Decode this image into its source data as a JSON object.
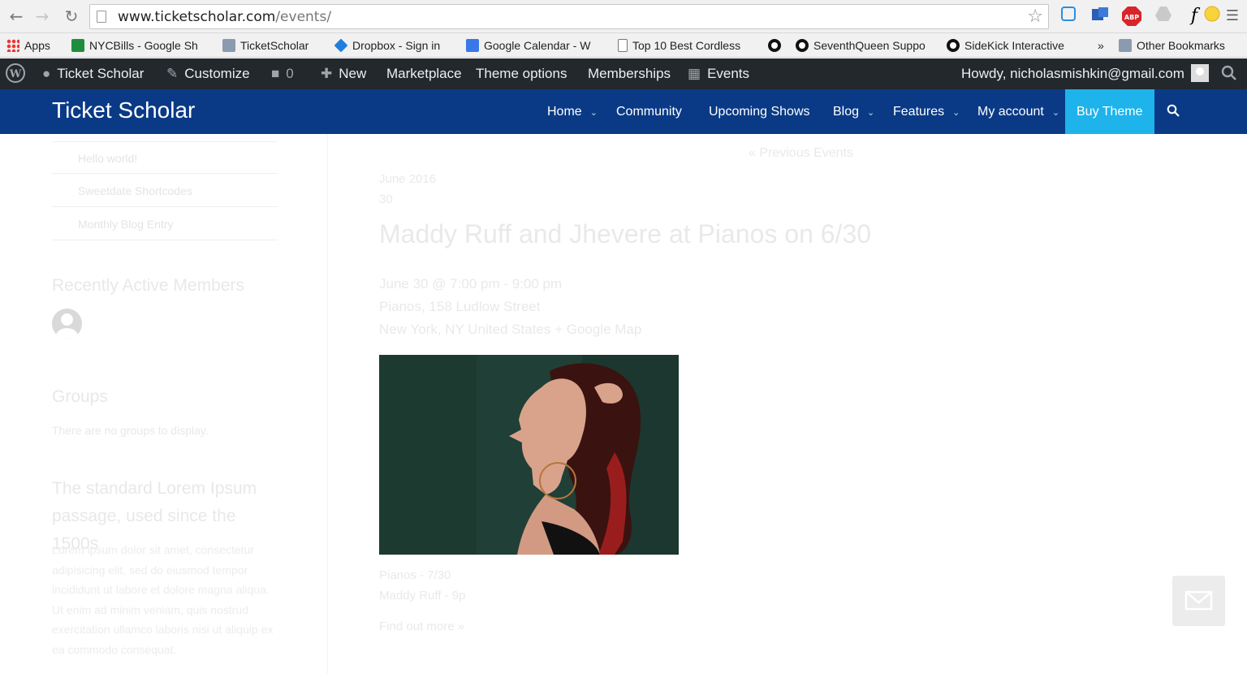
{
  "browser": {
    "url_domain": "www.ticketscholar.com",
    "url_path": "/events/",
    "bookmarks": [
      {
        "label": "Apps"
      },
      {
        "label": "NYCBills - Google Sh"
      },
      {
        "label": "TicketScholar"
      },
      {
        "label": "Dropbox - Sign in"
      },
      {
        "label": "Google Calendar - W"
      },
      {
        "label": "Top 10 Best Cordless"
      },
      {
        "label": "SeventhQueen Suppo"
      },
      {
        "label": "SideKick Interactive"
      },
      {
        "label": "»"
      },
      {
        "label": "Other Bookmarks"
      }
    ],
    "extensions": {
      "abp": "ABP",
      "fx": "f"
    }
  },
  "adminbar": {
    "site_name": "Ticket Scholar",
    "customize": "Customize",
    "comments_count": "0",
    "new": "New",
    "marketplace": "Marketplace",
    "theme_options": "Theme options",
    "memberships": "Memberships",
    "events": "Events",
    "howdy": "Howdy, nicholasmishkin@gmail.com"
  },
  "site": {
    "title": "Ticket Scholar",
    "menu": {
      "home": "Home",
      "community": "Community",
      "upcoming": "Upcoming Shows",
      "blog": "Blog",
      "features": "Features",
      "account": "My account",
      "buy": "Buy Theme"
    }
  },
  "sidebar": {
    "links": [
      "Hello world!",
      "Sweetdate Shortcodes",
      "Monthly Blog Entry"
    ],
    "members_heading": "Recently Active Members",
    "groups_heading": "Groups",
    "groups_text": "There are no groups to display.",
    "lorem_heading": "The standard Lorem Ipsum passage, used since the 1500s",
    "lorem_text": "Lorem ipsum dolor sit amet, consectetur adipisicing elit, sed do eiusmod tempor incididunt ut labore et dolore magna aliqua. Ut enim ad minim veniam, quis nostrud exercitation ullamco laboris nisi ut aliquip ex ea commodo consequat."
  },
  "event": {
    "prev_link": "« Previous Events",
    "month": "June 2016",
    "day": "30",
    "title": "Maddy Ruff and Jhevere at Pianos on 6/30",
    "datetime": "June 30 @ 7:00 pm - 9:00 pm",
    "venue": "Pianos, 158 Ludlow Street",
    "location": "New York, NY United States + Google Map",
    "price_line": "Pianos - 7/30",
    "artists_line": "Maddy Ruff - 9p",
    "find_out_more": "Find out more »"
  }
}
